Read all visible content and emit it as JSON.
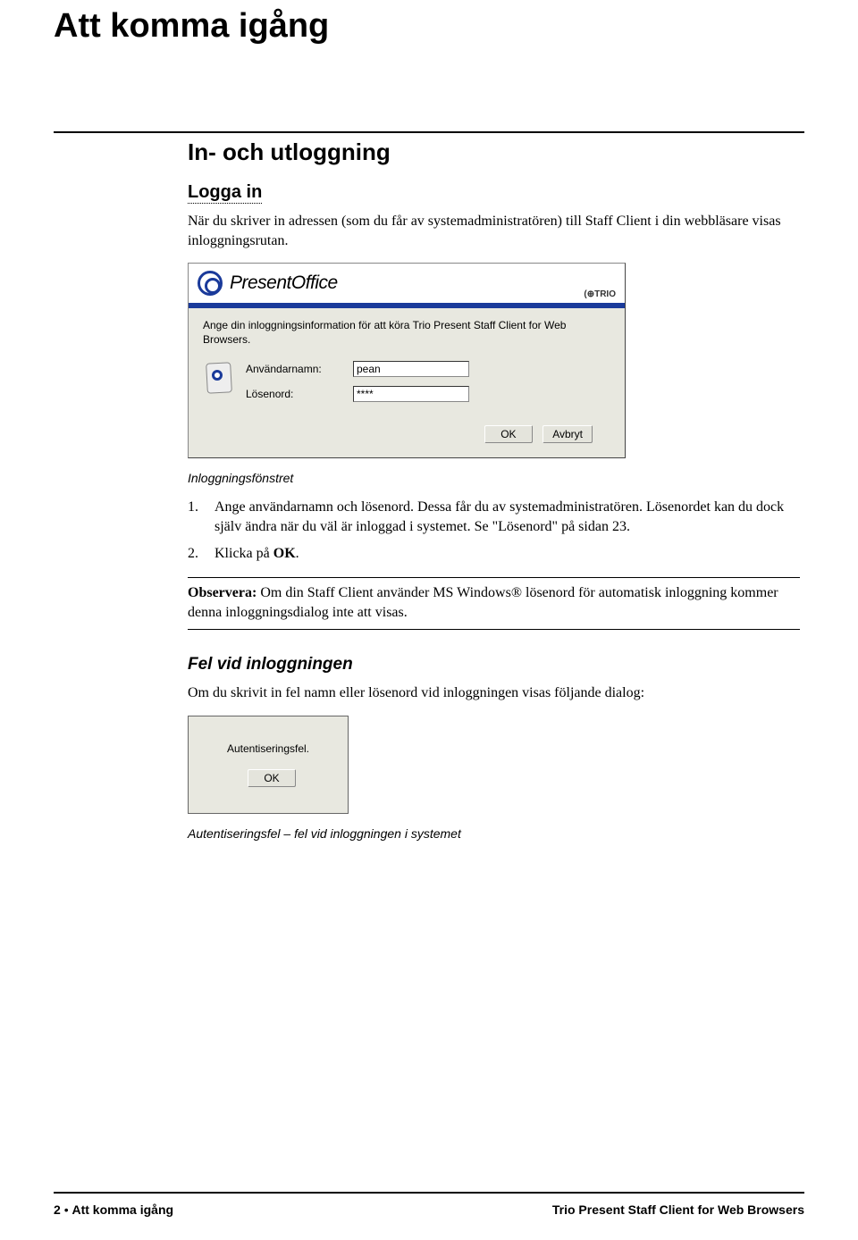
{
  "page_title": "Att komma igång",
  "section_title": "In- och utloggning",
  "subsection_login": "Logga in",
  "intro_text": "När du skriver in adressen (som du får av systemadministratören) till Staff Client i din webbläsare visas inloggningsrutan.",
  "login_window": {
    "app_title": "PresentOffice",
    "brand": "(⊕TRIO",
    "instruction": "Ange din inloggningsinformation för att köra Trio Present Staff Client for Web Browsers.",
    "username_label": "Användarnamn:",
    "username_value": "pean",
    "password_label": "Lösenord:",
    "password_value": "****",
    "ok_label": "OK",
    "cancel_label": "Avbryt"
  },
  "caption_login": "Inloggningsfönstret",
  "list_items": [
    {
      "num": "1.",
      "text_a": "Ange användarnamn och lösenord. Dessa får du av systemadministratören. Lösenordet kan du dock själv ändra när du väl är inloggad i systemet. Se \"Lösenord\" på sidan 23."
    },
    {
      "num": "2.",
      "text_a": "Klicka på ",
      "text_b_bold": "OK",
      "text_c": "."
    }
  ],
  "note_bold": "Observera:",
  "note_text": " Om din Staff Client använder MS Windows® lösenord för automatisk inloggning kommer denna inloggningsdialog  inte att visas.",
  "subsection_error": "Fel vid inloggningen",
  "error_intro": "Om du skrivit in fel namn eller lösenord vid inloggningen visas följande dialog:",
  "error_dialog": {
    "message": "Autentiseringsfel.",
    "ok_label": "OK"
  },
  "caption_error": "Autentiseringsfel – fel vid inloggningen i systemet",
  "footer": {
    "page_num": "2",
    "section": "Att komma igång",
    "doc_title": "Trio Present Staff Client for Web Browsers"
  }
}
